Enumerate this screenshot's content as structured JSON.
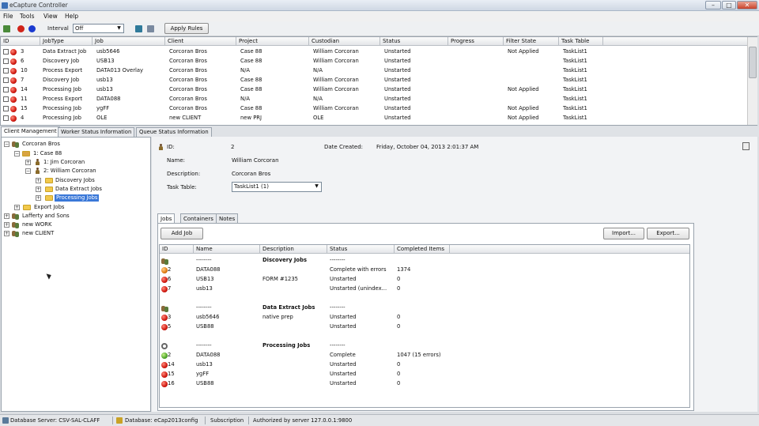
{
  "window": {
    "title": "eCapture Controller",
    "min": "–",
    "max": "□",
    "close": "✕"
  },
  "menu": [
    "File",
    "Tools",
    "View",
    "Help"
  ],
  "toolbar": {
    "interval_label": "Interval",
    "interval_value": "Off",
    "apply_rules": "Apply Rules"
  },
  "jobs_grid": {
    "columns": [
      "ID",
      "JobType",
      "Job",
      "Client",
      "Project",
      "Custodian",
      "Status",
      "Progress",
      "Filter State",
      "Task Table"
    ],
    "rows": [
      [
        "3",
        "Data Extract Job",
        "usb5646",
        "Corcoran Bros",
        "Case 88",
        "William Corcoran",
        "Unstarted",
        "",
        "Not Applied",
        "TaskList1"
      ],
      [
        "6",
        "Discovery Job",
        "USB13",
        "Corcoran Bros",
        "Case 88",
        "William Corcoran",
        "Unstarted",
        "",
        "",
        "TaskList1"
      ],
      [
        "10",
        "Process Export",
        "DATA013 Overlay",
        "Corcoran Bros",
        "N/A",
        "N/A",
        "Unstarted",
        "",
        "",
        "TaskList1"
      ],
      [
        "7",
        "Discovery Job",
        "usb13",
        "Corcoran Bros",
        "Case 88",
        "William Corcoran",
        "Unstarted",
        "",
        "",
        "TaskList1"
      ],
      [
        "14",
        "Processing Job",
        "usb13",
        "Corcoran Bros",
        "Case 88",
        "William Corcoran",
        "Unstarted",
        "",
        "Not Applied",
        "TaskList1"
      ],
      [
        "11",
        "Process Export",
        "DATA088",
        "Corcoran Bros",
        "N/A",
        "N/A",
        "Unstarted",
        "",
        "",
        "TaskList1"
      ],
      [
        "15",
        "Processing Job",
        "ygFF",
        "Corcoran Bros",
        "Case 88",
        "William Corcoran",
        "Unstarted",
        "",
        "Not Applied",
        "TaskList1"
      ],
      [
        "4",
        "Processing Job",
        "OLE",
        "new CLIENT",
        "new PRJ",
        "OLE",
        "Unstarted",
        "",
        "Not Applied",
        "TaskList1"
      ]
    ]
  },
  "tabs": [
    "Client Management",
    "Worker Status Information",
    "Queue Status Information"
  ],
  "tree": {
    "n0": "Corcoran Bros",
    "n1": "1: Case 88",
    "n2": "1: Jim Corcoran",
    "n3": "2: William Corcoran",
    "n4": "Discovery Jobs",
    "n5": "Data Extract Jobs",
    "n6": "Processing Jobs",
    "n7": "Export Jobs",
    "n8": "Lafferty and Sons",
    "n9": "new WORK",
    "n10": "new CLIENT"
  },
  "detail": {
    "id_label": "ID:",
    "id_value": "2",
    "date_label": "Date Created:",
    "date_value": "Friday, October 04, 2013 2:01:37 AM",
    "name_label": "Name:",
    "name_value": "William Corcoran",
    "desc_label": "Description:",
    "desc_value": "Corcoran Bros",
    "task_label": "Task Table:",
    "task_value": "TaskList1 (1)",
    "inner_tabs": [
      "Jobs",
      "Containers",
      "Notes"
    ],
    "add_job": "Add Job",
    "import": "Import...",
    "export": "Export..."
  },
  "sub_grid": {
    "columns": [
      "ID",
      "Name",
      "Description",
      "Status",
      "Completed Items"
    ],
    "rows": [
      {
        "id": "",
        "name": "--------",
        "desc": "Discovery Jobs",
        "status": "--------",
        "items": "",
        "icon": "group",
        "bold": true
      },
      {
        "id": "2",
        "name": "DATA088",
        "desc": "",
        "status": "Complete with errors",
        "items": "1374",
        "icon": "orange",
        "bold": false
      },
      {
        "id": "6",
        "name": "USB13",
        "desc": "FORM #1235",
        "status": "Unstarted",
        "items": "0",
        "icon": "red",
        "bold": false
      },
      {
        "id": "7",
        "name": "usb13",
        "desc": "",
        "status": "Unstarted (unindex...",
        "items": "0",
        "icon": "red",
        "bold": false
      },
      {
        "id": "",
        "name": "--------",
        "desc": "Data Extract Jobs",
        "status": "--------",
        "items": "",
        "icon": "group",
        "bold": true
      },
      {
        "id": "3",
        "name": "usb5646",
        "desc": "native prep",
        "status": "Unstarted",
        "items": "0",
        "icon": "red",
        "bold": false
      },
      {
        "id": "5",
        "name": "USB88",
        "desc": "",
        "status": "Unstarted",
        "items": "0",
        "icon": "red",
        "bold": false
      },
      {
        "id": "",
        "name": "--------",
        "desc": "Processing Jobs",
        "status": "--------",
        "items": "",
        "icon": "gear",
        "bold": true
      },
      {
        "id": "2",
        "name": "DATA088",
        "desc": "",
        "status": "Complete",
        "items": "1047 (15 errors)",
        "icon": "green",
        "bold": false
      },
      {
        "id": "14",
        "name": "usb13",
        "desc": "",
        "status": "Unstarted",
        "items": "0",
        "icon": "red",
        "bold": false
      },
      {
        "id": "15",
        "name": "ygFF",
        "desc": "",
        "status": "Unstarted",
        "items": "0",
        "icon": "red",
        "bold": false
      },
      {
        "id": "16",
        "name": "USB88",
        "desc": "",
        "status": "Unstarted",
        "items": "0",
        "icon": "red",
        "bold": false
      }
    ]
  },
  "statusbar": {
    "db_server": "Database Server: CSV-SAL-CLAFF",
    "database": "Database: eCap2013config",
    "subscription": "Subscription",
    "auth": "Authorized by server 127.0.0.1:9800"
  }
}
